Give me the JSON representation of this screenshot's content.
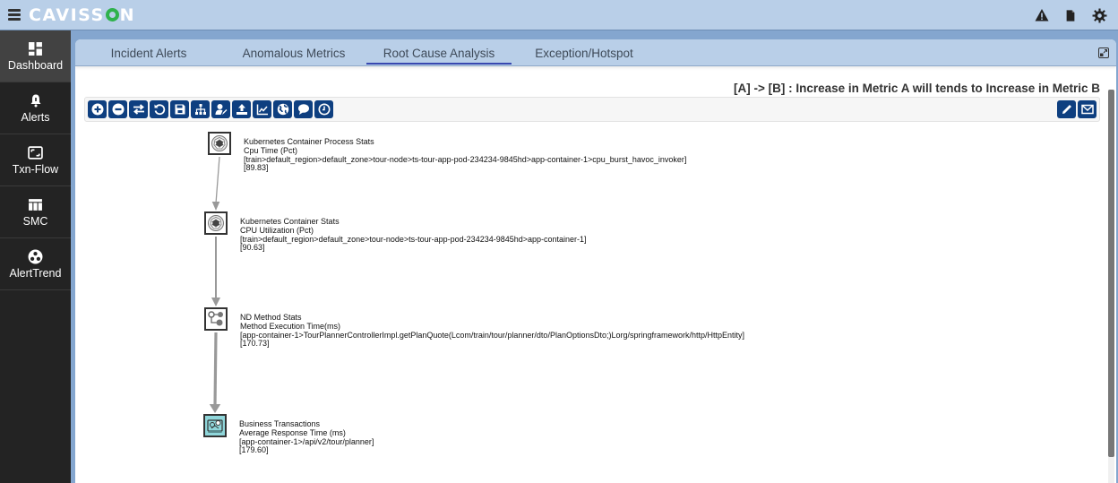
{
  "app": {
    "logo": "CAVISSON",
    "top_icons": [
      "warning-icon",
      "document-icon",
      "gear-icon"
    ]
  },
  "sidebar": {
    "items": [
      {
        "label": "Dashboard",
        "icon": "dashboard-icon",
        "active": true
      },
      {
        "label": "Alerts",
        "icon": "bell-icon",
        "active": false
      },
      {
        "label": "Txn-Flow",
        "icon": "txn-flow-icon",
        "active": false
      },
      {
        "label": "SMC",
        "icon": "table-icon",
        "active": false
      },
      {
        "label": "AlertTrend",
        "icon": "alert-trend-icon",
        "active": false
      }
    ]
  },
  "tabs": [
    {
      "label": "Incident Alerts",
      "active": false
    },
    {
      "label": "Anomalous Metrics",
      "active": false
    },
    {
      "label": "Root Cause Analysis",
      "active": true
    },
    {
      "label": "Exception/Hotspot",
      "active": false
    }
  ],
  "legend": "[A] -> [B] : Increase in Metric A will tends to Increase in Metric B",
  "toolbar": {
    "left": [
      {
        "name": "zoom-in-button",
        "icon": "plus-circle-icon"
      },
      {
        "name": "zoom-out-button",
        "icon": "minus-circle-icon"
      },
      {
        "name": "swap-button",
        "icon": "swap-arrows-icon"
      },
      {
        "name": "reset-button",
        "icon": "undo-icon"
      },
      {
        "name": "save-button",
        "icon": "floppy-icon"
      },
      {
        "name": "hierarchy-button",
        "icon": "sitemap-icon"
      },
      {
        "name": "user-edit-button",
        "icon": "user-edit-icon"
      },
      {
        "name": "upload-button",
        "icon": "upload-icon"
      },
      {
        "name": "chart-button",
        "icon": "line-chart-icon"
      },
      {
        "name": "globe-button",
        "icon": "globe-icon"
      },
      {
        "name": "comment-button",
        "icon": "comment-icon"
      },
      {
        "name": "clock-button",
        "icon": "clock-icon"
      }
    ],
    "right": [
      {
        "name": "edit-button",
        "icon": "pencil-icon"
      },
      {
        "name": "email-button",
        "icon": "envelope-icon"
      }
    ]
  },
  "nodes": [
    {
      "icon": "kubernetes-icon",
      "group": "Kubernetes Container Process Stats",
      "metric": "Cpu Time (Pct)",
      "path": "[train>default_region>default_zone>tour-node>ts-tour-app-pod-234234-9845hd>app-container-1>cpu_burst_havoc_invoker]",
      "value": "[89.83]"
    },
    {
      "icon": "kubernetes-icon",
      "group": "Kubernetes Container Stats",
      "metric": "CPU Utilization (Pct)",
      "path": "[train>default_region>default_zone>tour-node>ts-tour-app-pod-234234-9845hd>app-container-1]",
      "value": "[90.63]"
    },
    {
      "icon": "method-flow-icon",
      "group": "ND Method Stats",
      "metric": "Method Execution Time(ms)",
      "path": "[app-container-1>TourPlannerControllerImpl.getPlanQuote(Lcom/train/tour/planner/dto/PlanOptionsDto;)Lorg/springframework/http/HttpEntity]",
      "value": "[170.73]"
    },
    {
      "icon": "business-transaction-icon",
      "group": "Business Transactions",
      "metric": "Average Response Time (ms)",
      "path": "[app-container-1>/api/v2/tour/planner]",
      "value": "[179.60]"
    }
  ],
  "edges": [
    {
      "from": 0,
      "to": 1
    },
    {
      "from": 1,
      "to": 2
    },
    {
      "from": 2,
      "to": 3
    }
  ],
  "colors": {
    "topbar": "#b9cfe8",
    "sidebar": "#232323",
    "toolbar_button": "#0e3f80",
    "active_tab_underline": "#3848b0",
    "bt_node_fill": "#8fd6da"
  }
}
